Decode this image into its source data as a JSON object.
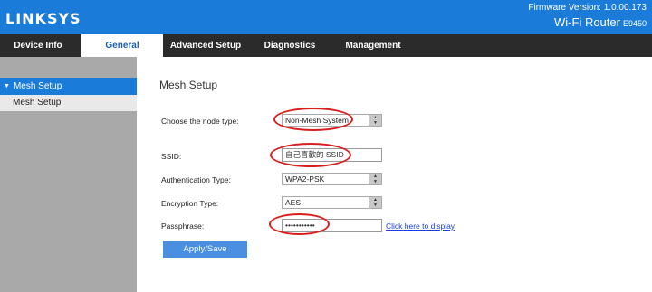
{
  "header": {
    "logo": "LINKSYS",
    "firmware": "Firmware Version: 1.0.00.173",
    "product": "Wi-Fi Router",
    "model_code": "E9450",
    "bg_color": "#1a7bd8"
  },
  "nav": {
    "tabs": [
      {
        "label": "Device Info"
      },
      {
        "label": "General"
      },
      {
        "label": "Advanced Setup"
      },
      {
        "label": "Diagnostics"
      },
      {
        "label": "Management"
      }
    ],
    "active": "General"
  },
  "sidebar": {
    "section": "Mesh Setup",
    "items": [
      {
        "label": "Mesh Setup"
      }
    ]
  },
  "main": {
    "title": "Mesh Setup",
    "node_type": {
      "label": "Choose the node type:",
      "value": "Non-Mesh System"
    },
    "ssid": {
      "label": "SSID:",
      "value": "自己喜歡的 SSID"
    },
    "auth": {
      "label": "Authentication Type:",
      "value": "WPA2-PSK"
    },
    "encryption": {
      "label": "Encryption Type:",
      "value": "AES"
    },
    "passphrase": {
      "label": "Passphrase:",
      "value": "•••••••••••",
      "display_link": "Click here to display"
    },
    "apply_label": "Apply/Save"
  },
  "annotation_color": "#d81f1f"
}
